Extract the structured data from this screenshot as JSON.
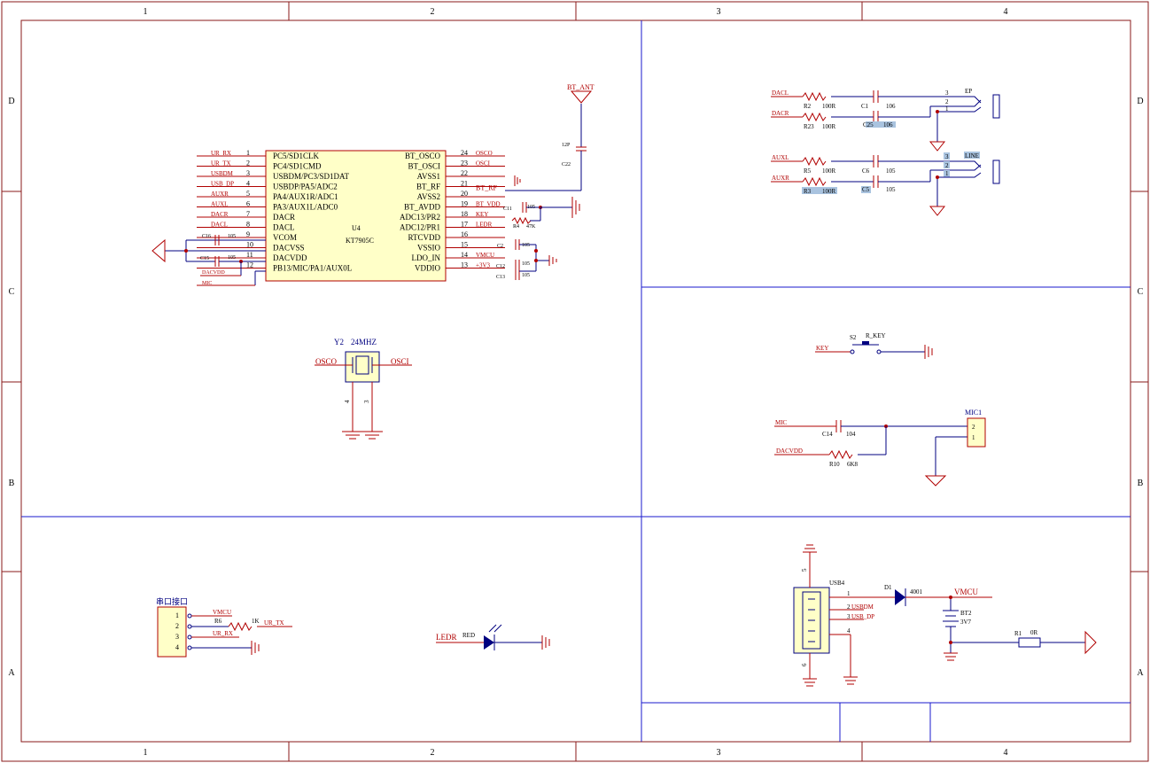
{
  "frame": {
    "col_labels": [
      "1",
      "2",
      "3",
      "4"
    ],
    "row_labels": [
      "D",
      "C",
      "B",
      "A"
    ]
  },
  "chip": {
    "designator": "U4",
    "part": "KT7905C",
    "left_pins": [
      {
        "num": "1",
        "name": "PC5/SD1CLK",
        "net": "UR_RX"
      },
      {
        "num": "2",
        "name": "PC4/SD1CMD",
        "net": "UR_TX"
      },
      {
        "num": "3",
        "name": "USBDM/PC3/SD1DAT",
        "net": "USBDM"
      },
      {
        "num": "4",
        "name": "USBDP/PA5/ADC2",
        "net": "USB_DP"
      },
      {
        "num": "5",
        "name": "PA4/AUX1R/ADC1",
        "net": "AUXR"
      },
      {
        "num": "6",
        "name": "PA3/AUX1L/ADC0",
        "net": "AUXL"
      },
      {
        "num": "7",
        "name": "DACR",
        "net": "DACR"
      },
      {
        "num": "8",
        "name": "DACL",
        "net": "DACL"
      },
      {
        "num": "9",
        "name": "VCOM",
        "net": ""
      },
      {
        "num": "10",
        "name": "DACVSS",
        "net": ""
      },
      {
        "num": "11",
        "name": "DACVDD",
        "net": ""
      },
      {
        "num": "12",
        "name": "PB13/MIC/PA1/AUX0L",
        "net": ""
      }
    ],
    "right_pins": [
      {
        "num": "24",
        "name": "BT_OSCO",
        "net": "OSCO"
      },
      {
        "num": "23",
        "name": "BT_OSCI",
        "net": "OSCI"
      },
      {
        "num": "22",
        "name": "AVSS1",
        "net": ""
      },
      {
        "num": "21",
        "name": "BT_RF",
        "net": "BT_RF"
      },
      {
        "num": "20",
        "name": "AVSS2",
        "net": ""
      },
      {
        "num": "19",
        "name": "BT_AVDD",
        "net": "BT_VDD"
      },
      {
        "num": "18",
        "name": "ADC13/PR2",
        "net": "KEY"
      },
      {
        "num": "17",
        "name": "ADC12/PR1",
        "net": "LEDR"
      },
      {
        "num": "16",
        "name": "RTCVDD",
        "net": ""
      },
      {
        "num": "15",
        "name": "VSSIO",
        "net": ""
      },
      {
        "num": "14",
        "name": "LDO_IN",
        "net": "VMCU"
      },
      {
        "num": "13",
        "name": "VDDIO",
        "net": "+3V3"
      }
    ],
    "cap_c16": {
      "ref": "C16",
      "val": "105"
    },
    "cap_c15": {
      "ref": "C15",
      "val": "105"
    },
    "net_dacvdd": "DACVDD",
    "net_mic": "MIC",
    "cap_c11": {
      "ref": "C11",
      "val": "105"
    },
    "res_r4": {
      "ref": "R4",
      "val": "47K"
    },
    "cap_c2": {
      "ref": "C2",
      "val": "105"
    },
    "cap_c12": {
      "ref": "C12",
      "val": "105"
    },
    "cap_c13": {
      "ref": "C13",
      "val": "105"
    }
  },
  "antenna": {
    "net": "BT_ANT",
    "cap_val": "12P",
    "cap_ref": "C22"
  },
  "crystal": {
    "ref": "Y2",
    "val": "24MHZ",
    "left_net": "OSCO",
    "right_net": "OSCI",
    "pin_a": "4",
    "pin_b": "3"
  },
  "audio_out": {
    "ep_rows": [
      {
        "net": "DACL",
        "res_ref": "R2",
        "res_val": "100R",
        "cap_ref": "C1",
        "cap_val": "106",
        "pin": "3"
      },
      {
        "net": "DACR",
        "res_ref": "R23",
        "res_val": "100R",
        "cap_ref": "C25",
        "cap_val": "106",
        "pin": "2"
      }
    ],
    "ep_pin_extra": "1",
    "ep_label": "EP",
    "line_rows": [
      {
        "net": "AUXL",
        "res_ref": "R5",
        "res_val": "100R",
        "cap_ref": "C6",
        "cap_val": "105",
        "pin": "3"
      },
      {
        "net": "AUXR",
        "res_ref": "R3",
        "res_val": "100R",
        "cap_ref": "C5",
        "cap_val": "105",
        "pin": "2"
      }
    ],
    "line_pin_extra": "1",
    "line_label": "LINE"
  },
  "key": {
    "net": "KEY",
    "ref": "S2",
    "val": "R_KEY"
  },
  "mic": {
    "net": "MIC",
    "cap_ref": "C14",
    "cap_val": "104",
    "bias_net": "DACVDD",
    "res_ref": "R10",
    "res_val": "6K8",
    "conn_ref": "MIC1",
    "pin_top": "2",
    "pin_bot": "1"
  },
  "uart": {
    "title": "串口接口",
    "pins": [
      "1",
      "2",
      "3",
      "4"
    ],
    "nets": [
      "VMCU",
      "",
      "UR_RX",
      ""
    ],
    "res_ref": "R6",
    "res_val": "1K",
    "res_net": "UR_TX"
  },
  "led": {
    "net": "LEDR",
    "val": "RED"
  },
  "usb": {
    "ref": "USB4",
    "pins": [
      "1",
      "2",
      "3",
      "4"
    ],
    "shield_top": "5",
    "shield_bot": "6",
    "net_dm": "USBDM",
    "net_dp": "USB_DP",
    "diode_ref": "D1",
    "diode_val": "4001",
    "vmcu": "VMCU",
    "batt_ref": "BT2",
    "batt_val": "3V7",
    "r1_ref": "R1",
    "r1_val": "0R"
  }
}
